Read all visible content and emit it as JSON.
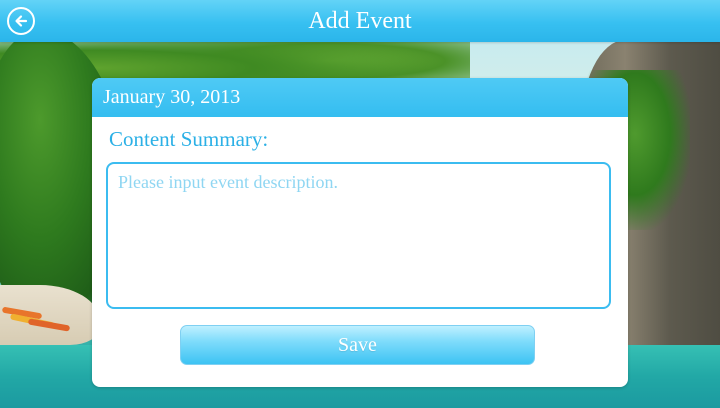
{
  "header": {
    "title": "Add Event",
    "back_icon": "back-arrow-icon"
  },
  "card": {
    "date": "January 30, 2013",
    "content_label": "Content Summary:",
    "description_placeholder": "Please input event description.",
    "description_value": "",
    "save_label": "Save"
  },
  "colors": {
    "accent": "#37c0f1",
    "label_text": "#2bb0e6",
    "placeholder_text": "#8fd6f2"
  }
}
